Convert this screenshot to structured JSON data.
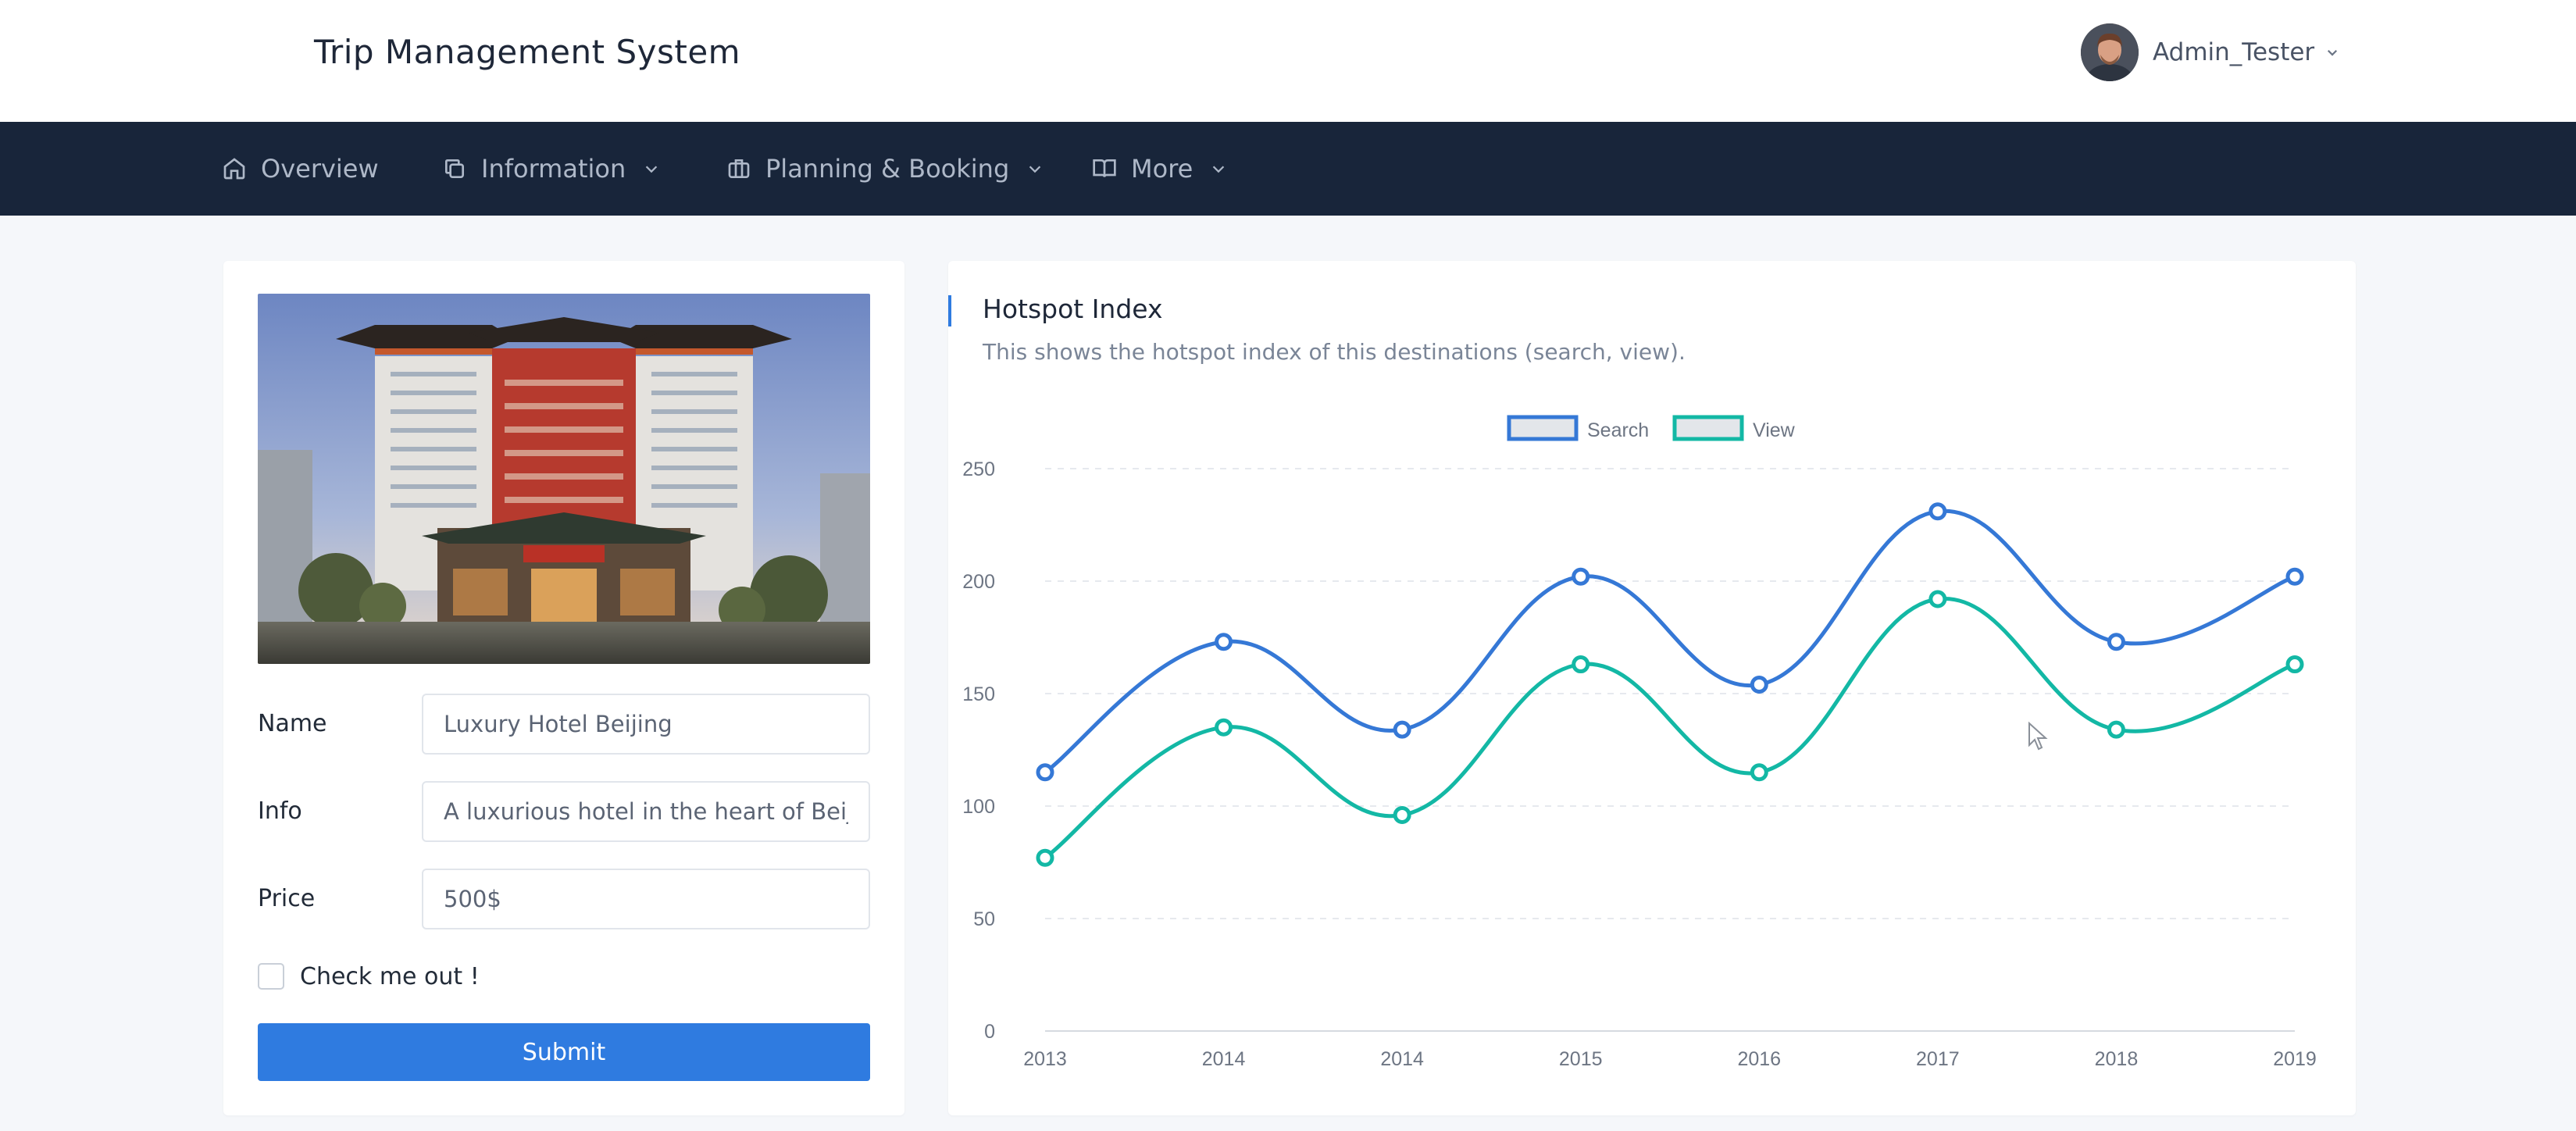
{
  "header": {
    "app_title": "Trip Management System",
    "user_name": "Admin_Tester"
  },
  "nav": {
    "items": [
      {
        "label": "Overview",
        "icon": "home-icon",
        "has_dropdown": false
      },
      {
        "label": "Information",
        "icon": "copy-icon",
        "has_dropdown": true
      },
      {
        "label": "Planning & Booking",
        "icon": "briefcase-icon",
        "has_dropdown": true
      },
      {
        "label": "More",
        "icon": "book-open-icon",
        "has_dropdown": true
      }
    ]
  },
  "form": {
    "name_label": "Name",
    "name_value": "Luxury Hotel Beijing",
    "info_label": "Info",
    "info_value": "A luxurious hotel in the heart of Beijing",
    "price_label": "Price",
    "price_value": "500$",
    "checkbox_label": "Check me out !",
    "checkbox_checked": false,
    "submit_label": "Submit"
  },
  "chart": {
    "title": "Hotspot Index",
    "subtitle": "This shows the hotspot index of this destinations (search, view)."
  },
  "chart_data": {
    "type": "line",
    "categories": [
      "2013",
      "2014",
      "2014",
      "2015",
      "2016",
      "2017",
      "2018",
      "2019"
    ],
    "series": [
      {
        "name": "Search",
        "values": [
          115,
          173,
          134,
          202,
          154,
          231,
          173,
          202
        ],
        "color": "#3578d6"
      },
      {
        "name": "View",
        "values": [
          77,
          135,
          96,
          163,
          115,
          192,
          134,
          163
        ],
        "color": "#13b8a5"
      }
    ],
    "yticks": [
      0,
      50,
      100,
      150,
      200,
      250
    ],
    "ylim": [
      0,
      250
    ],
    "grid": true,
    "legend_position": "top-center"
  },
  "colors": {
    "nav_bg": "#18253a",
    "accent": "#2f7be0",
    "page_bg": "#f5f7fa"
  }
}
